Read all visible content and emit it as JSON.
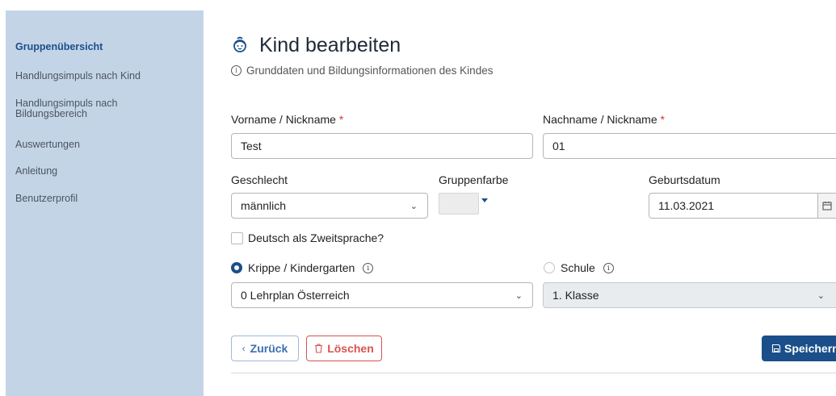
{
  "sidebar": {
    "items": [
      {
        "label": "Gruppenübersicht",
        "active": true
      },
      {
        "label": "Handlungsimpuls nach Kind"
      },
      {
        "label": "Handlungsimpuls nach"
      },
      {
        "label": "Bildungsbereich"
      },
      {
        "label": "Auswertungen"
      },
      {
        "label": "Anleitung"
      },
      {
        "label": "Benutzerprofil"
      }
    ]
  },
  "header": {
    "title": "Kind bearbeiten",
    "subtitle": "Grunddaten und Bildungsinformationen des Kindes",
    "title_icon": "child-face-icon",
    "info_icon": "info-icon"
  },
  "form": {
    "vorname_label": "Vorname / Nickname",
    "vorname_value": "Test",
    "nachname_label": "Nachname / Nickname",
    "nachname_value": "01",
    "required_mark": "*",
    "geschlecht_label": "Geschlecht",
    "geschlecht_value": "männlich",
    "gruppenfarbe_label": "Gruppenfarbe",
    "geburtsdatum_label": "Geburtsdatum",
    "geburtsdatum_value": "11.03.2021",
    "deutsch_label": "Deutsch als Zweitsprache?",
    "deutsch_checked": false,
    "krippe_label": "Krippe / Kindergarten",
    "krippe_selected": true,
    "schule_label": "Schule",
    "schule_selected": false,
    "lehrplan_value": "0 Lehrplan Österreich",
    "klasse_value": "1. Klasse"
  },
  "buttons": {
    "back_label": "Zurück",
    "delete_label": "Löschen",
    "save_label": "Speichern"
  },
  "colors": {
    "sidebar_bg": "#c4d4e7",
    "primary": "#1a4f8a",
    "danger": "#d9534f",
    "back_blue": "#3a6fb0"
  }
}
